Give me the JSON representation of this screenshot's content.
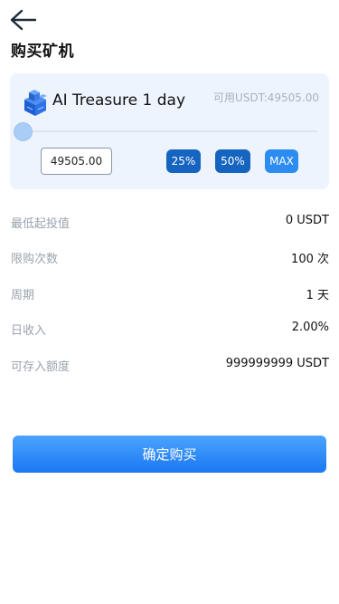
{
  "header": {
    "back_icon": "arrow-left-icon",
    "title": "购买矿机"
  },
  "product": {
    "icon": "cube-stack-icon",
    "name": "AI Treasure 1 day",
    "balance": "可用USDT:49505.00"
  },
  "amount": {
    "value": "49505.00",
    "slider_level_percent": 0
  },
  "quick_buttons": {
    "btn_25": "25%",
    "btn_50": "50%",
    "btn_max": "MAX"
  },
  "details": [
    {
      "label": "最低起投值",
      "value": "0 USDT"
    },
    {
      "label": "限购次数",
      "value": "100 次"
    },
    {
      "label": "周期",
      "value": "1 天"
    },
    {
      "label": "日收入",
      "value": "2.00%"
    },
    {
      "label": "可存入额度",
      "value": "999999999 USDT"
    }
  ],
  "confirm_label": "确定购买",
  "colors": {
    "accent": "#1565c0",
    "max_button": "#2d8cf0",
    "card_bg": "#edf4fe",
    "confirm_gradient_top": "#4ba3ff",
    "confirm_gradient_bottom": "#1a78f2"
  }
}
